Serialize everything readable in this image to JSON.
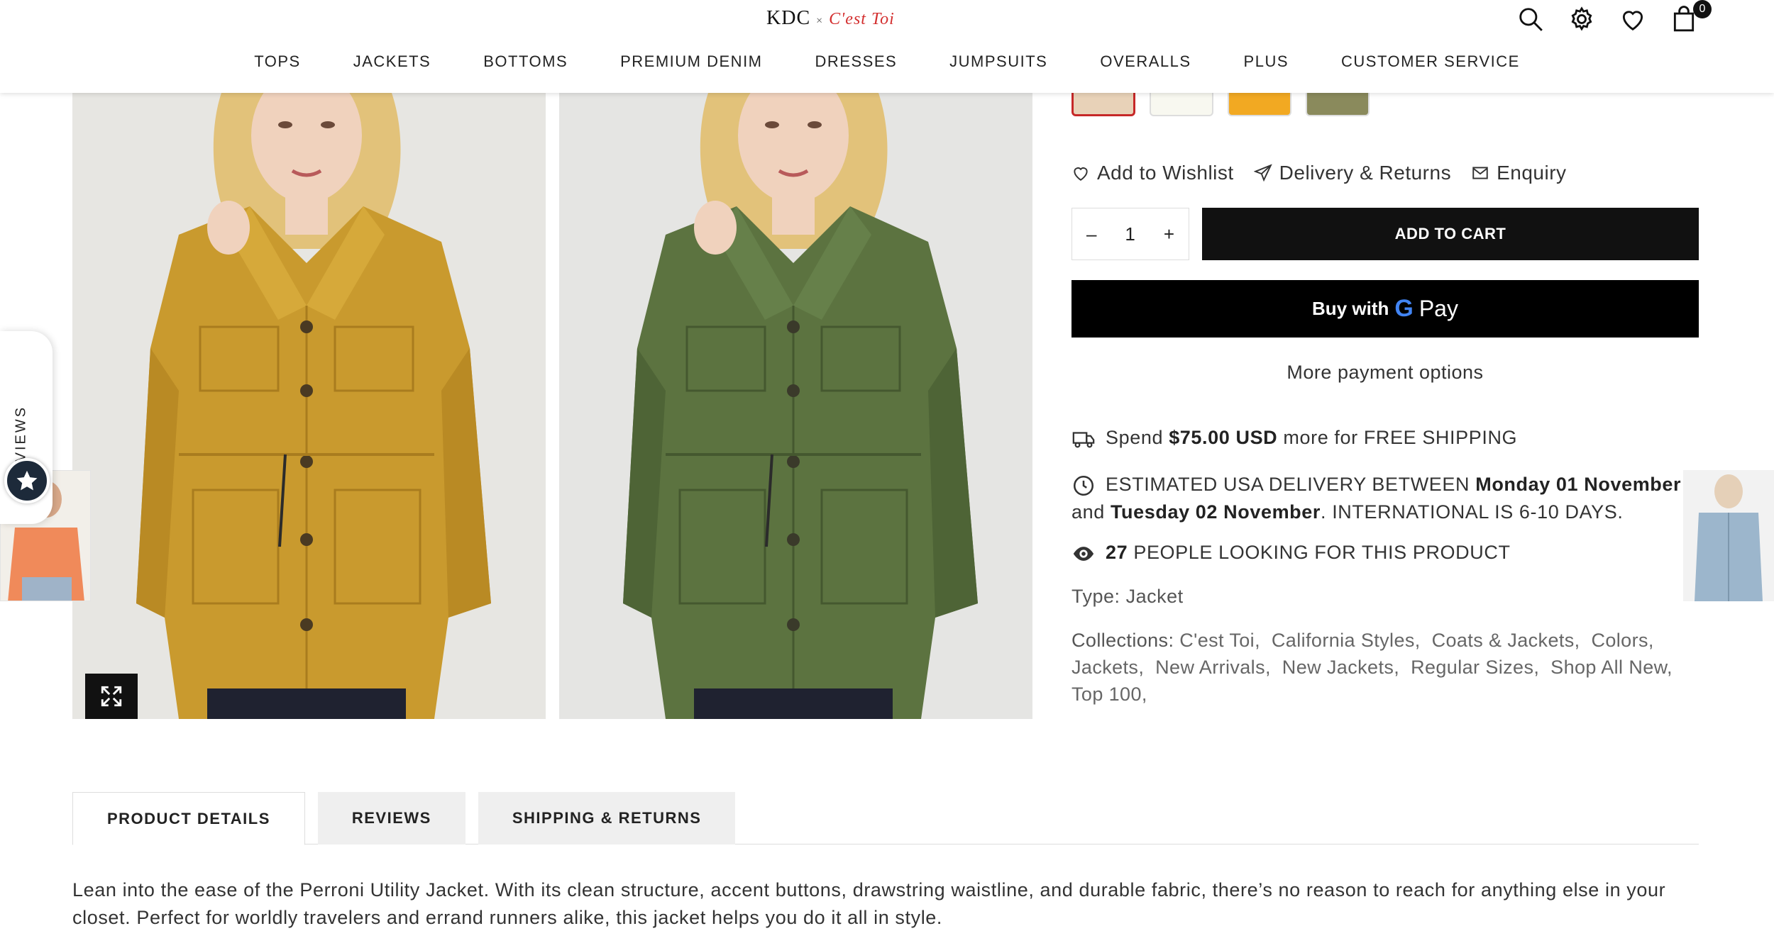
{
  "brand": {
    "logo_main": "KDC",
    "logo_x": "×",
    "logo_partner": "C'est Toi"
  },
  "header": {
    "cart_count": "0"
  },
  "nav": [
    "TOPS",
    "JACKETS",
    "BOTTOMS",
    "PREMIUM DENIM",
    "DRESSES",
    "JUMPSUITS",
    "OVERALLS",
    "PLUS",
    "CUSTOMER SERVICE"
  ],
  "reviews_tab": {
    "label": "REVIEWS"
  },
  "swatches": [
    {
      "color": "#e8d2b8",
      "selected": true
    },
    {
      "color": "#f8f8f0",
      "selected": false
    },
    {
      "color": "#f2a922",
      "selected": false
    },
    {
      "color": "#8a8a5c",
      "selected": false
    }
  ],
  "actions": {
    "wishlist": "Add to Wishlist",
    "delivery": "Delivery & Returns",
    "enquiry": "Enquiry"
  },
  "quantity": {
    "minus": "–",
    "value": "1",
    "plus": "+"
  },
  "add_to_cart": "ADD TO CART",
  "gpay": {
    "buy_with": "Buy with",
    "g": "G",
    "pay": "Pay"
  },
  "more_payment": "More payment options",
  "shipping": {
    "pre": "Spend",
    "amount": "$75.00 USD",
    "post": "more for FREE SHIPPING"
  },
  "delivery": {
    "pre": "ESTIMATED USA DELIVERY BETWEEN",
    "date1": "Monday 01 November",
    "and": "and",
    "date2": "Tuesday 02 November",
    "post": ". INTERNATIONAL IS 6-10 DAYS."
  },
  "viewers": {
    "count": "27",
    "text": "PEOPLE LOOKING FOR THIS PRODUCT"
  },
  "type": {
    "label": "Type:",
    "value": "Jacket"
  },
  "collections": {
    "label": "Collections:",
    "items": [
      "C'est Toi,",
      "California Styles,",
      "Coats & Jackets,",
      "Colors,",
      "Jackets,",
      "New Arrivals,",
      "New Jackets,",
      "Regular Sizes,",
      "Shop All New,",
      "Top 100,"
    ]
  },
  "tabs": [
    "PRODUCT DETAILS",
    "REVIEWS",
    "SHIPPING & RETURNS"
  ],
  "description": "Lean into the ease of the Perroni Utility Jacket. With its clean structure, accent buttons, drawstring waistline, and durable fabric, there’s no reason to reach for anything else in your closet. Perfect for worldly travelers and errand runners alike, this jacket helps you do it all in style.",
  "colors": {
    "mustard": "#c99a2e",
    "olive": "#5c7340",
    "accent": "#c62828"
  }
}
